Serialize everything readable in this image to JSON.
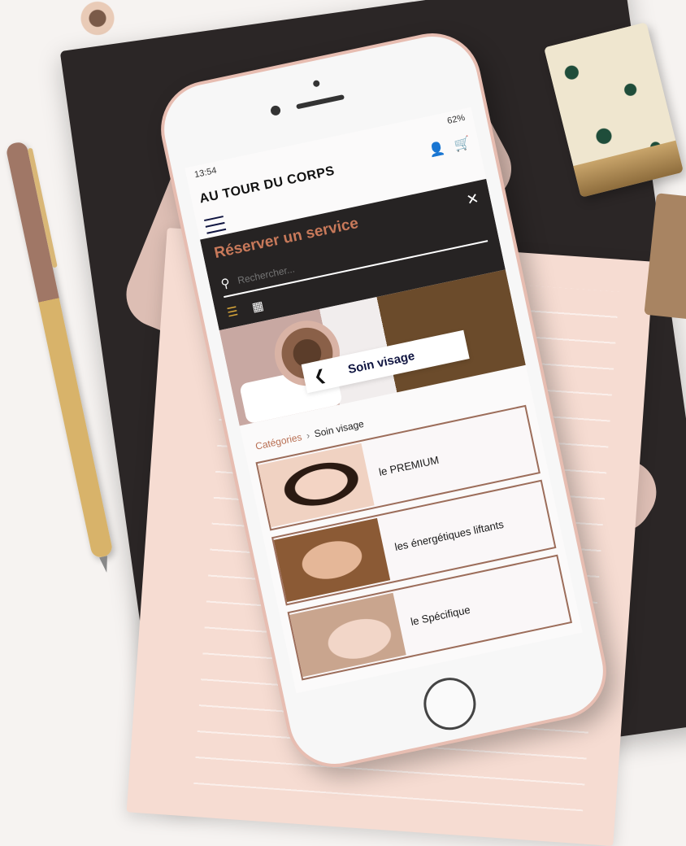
{
  "status": {
    "time": "13:54",
    "battery": "62%"
  },
  "header": {
    "brand": "AU TOUR DU CORPS"
  },
  "booking_panel": {
    "title": "Réserver un service",
    "search_placeholder": "Rechercher..."
  },
  "category_hero": {
    "title": "Soin visage"
  },
  "breadcrumb": {
    "root": "Catégories",
    "separator": "›",
    "current": "Soin visage"
  },
  "services": [
    {
      "label": "le PREMIUM"
    },
    {
      "label": "les énergétiques liftants"
    },
    {
      "label": "le Spécifique"
    }
  ],
  "colors": {
    "accent": "#c8795a",
    "navy": "#0f1440",
    "panel_bg": "#262323"
  },
  "icons": [
    "user-icon",
    "cart-icon",
    "menu-icon",
    "close-icon",
    "search-icon",
    "list-view-icon",
    "grid-view-icon",
    "chevron-left-icon"
  ]
}
